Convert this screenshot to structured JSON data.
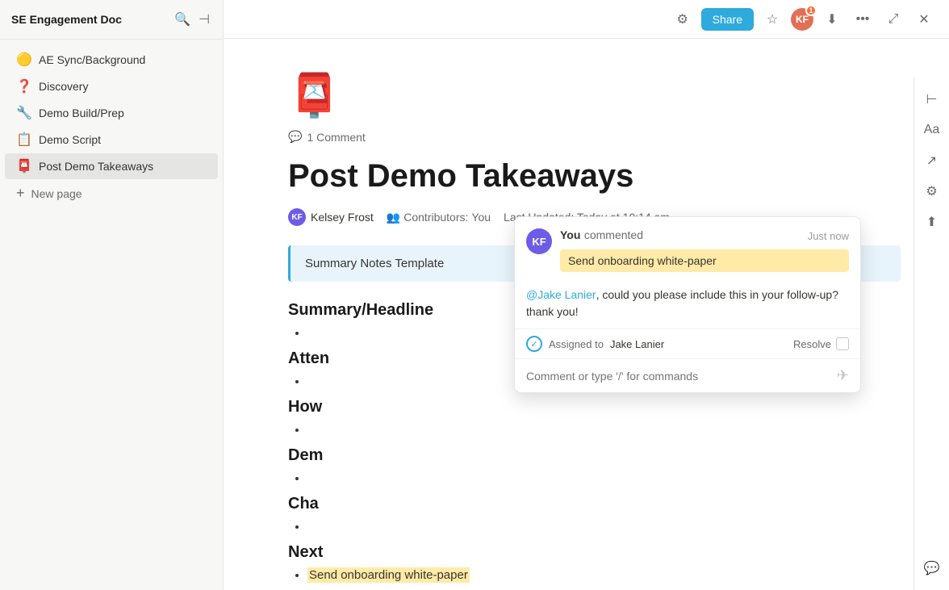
{
  "sidebar": {
    "title": "SE Engagement Doc",
    "items": [
      {
        "id": "ae-sync",
        "label": "AE Sync/Background",
        "emoji": "🟡",
        "active": false
      },
      {
        "id": "discovery",
        "label": "Discovery",
        "emoji": "❓",
        "active": false
      },
      {
        "id": "demo-build-prep",
        "label": "Demo Build/Prep",
        "emoji": "🔧",
        "active": false
      },
      {
        "id": "demo-script",
        "label": "Demo Script",
        "emoji": "📋",
        "active": false
      },
      {
        "id": "post-demo-takeaways",
        "label": "Post Demo Takeaways",
        "emoji": "📮",
        "active": true
      }
    ],
    "new_page_label": "New page"
  },
  "topbar": {
    "share_label": "Share"
  },
  "page": {
    "emoji": "📮",
    "comment_count": "1 Comment",
    "title": "Post Demo Takeaways",
    "author": "Kelsey Frost",
    "contributors_label": "Contributors:",
    "contributors_value": "You",
    "last_updated_label": "Last Updated:",
    "last_updated_value": "Today at 10:14 am",
    "callout": "Summary Notes Template",
    "sections": [
      {
        "heading": "Summary/Headline",
        "bullets": [
          ""
        ]
      },
      {
        "heading": "Atten",
        "bullets": [
          ""
        ]
      },
      {
        "heading": "How",
        "bullets": [
          ""
        ]
      },
      {
        "heading": "Dem",
        "bullets": [
          ""
        ]
      },
      {
        "heading": "Cha",
        "bullets": [
          ""
        ]
      },
      {
        "heading": "Next",
        "bullets": [
          "Send onboarding white-paper"
        ]
      }
    ]
  },
  "comment_popup": {
    "author": "You",
    "action": "commented",
    "time": "Just now",
    "highlight": "Send onboarding white-paper",
    "mention": "@Jake Lanier",
    "mention_text": ", could you please include this in your follow-up? thank you!",
    "assigned_to_label": "Assigned to",
    "assigned_to_name": "Jake Lanier",
    "resolve_label": "Resolve",
    "input_placeholder": "Comment or type '/' for commands"
  }
}
